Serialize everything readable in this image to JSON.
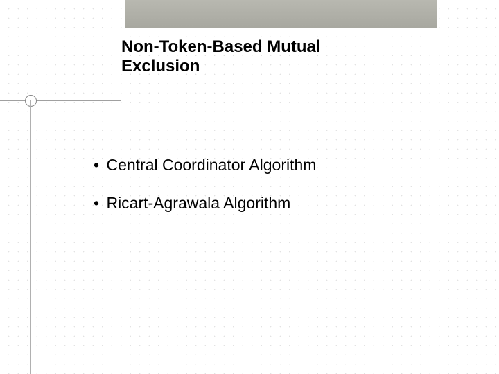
{
  "title": "Non-Token-Based Mutual Exclusion",
  "bullets": [
    "Central Coordinator Algorithm",
    "Ricart-Agrawala Algorithm"
  ],
  "bullet_char": "•"
}
